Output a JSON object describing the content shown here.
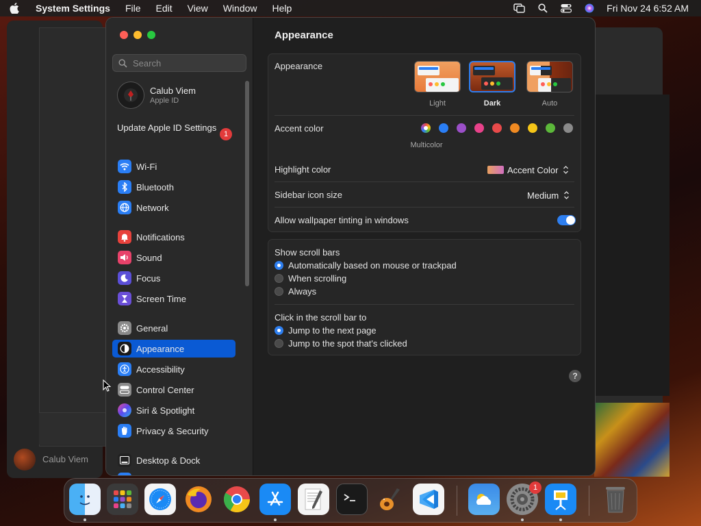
{
  "menubar": {
    "app_name": "System Settings",
    "menus": [
      "File",
      "Edit",
      "View",
      "Window",
      "Help"
    ],
    "clock": "Fri Nov 24  6:52 AM"
  },
  "background": {
    "user_name": "Calub Viem"
  },
  "sidebar": {
    "search_placeholder": "Search",
    "account": {
      "name": "Calub Viem",
      "subtitle": "Apple ID"
    },
    "update": {
      "label": "Update Apple ID Settings",
      "badge": "1"
    },
    "items": [
      {
        "label": "Wi-Fi",
        "icon": "wifi-icon",
        "color": "#2a7ef5"
      },
      {
        "label": "Bluetooth",
        "icon": "bluetooth-icon",
        "color": "#2a7ef5"
      },
      {
        "label": "Network",
        "icon": "globe-icon",
        "color": "#2a7ef5"
      },
      {
        "label": "Notifications",
        "icon": "bell-icon",
        "color": "#e8423c"
      },
      {
        "label": "Sound",
        "icon": "speaker-icon",
        "color": "#e8426a"
      },
      {
        "label": "Focus",
        "icon": "moon-icon",
        "color": "#5b4fd8"
      },
      {
        "label": "Screen Time",
        "icon": "hourglass-icon",
        "color": "#6a4fd8"
      },
      {
        "label": "General",
        "icon": "gear-icon",
        "color": "#8a8a8a"
      },
      {
        "label": "Appearance",
        "icon": "appearance-icon",
        "color": "#1a1a1a",
        "selected": true
      },
      {
        "label": "Accessibility",
        "icon": "accessibility-icon",
        "color": "#2a7ef5"
      },
      {
        "label": "Control Center",
        "icon": "control-center-icon",
        "color": "#8a8a8a"
      },
      {
        "label": "Siri & Spotlight",
        "icon": "siri-icon",
        "color": "#b04ad8"
      },
      {
        "label": "Privacy & Security",
        "icon": "hand-icon",
        "color": "#2a7ef5"
      },
      {
        "label": "Desktop & Dock",
        "icon": "dock-icon",
        "color": "#222222"
      }
    ]
  },
  "content": {
    "title": "Appearance",
    "appearance": {
      "label": "Appearance",
      "options": [
        {
          "label": "Light",
          "selected": false
        },
        {
          "label": "Dark",
          "selected": true
        },
        {
          "label": "Auto",
          "selected": false
        }
      ]
    },
    "accent": {
      "label": "Accent color",
      "selected_caption": "Multicolor",
      "colors": [
        "multicolor",
        "#2a7ef5",
        "#9b4fc8",
        "#e8428a",
        "#e84a4a",
        "#f08a22",
        "#f5c518",
        "#5cb83a",
        "#8a8a8a"
      ]
    },
    "highlight": {
      "label": "Highlight color",
      "value": "Accent Color"
    },
    "sidebar_icon_size": {
      "label": "Sidebar icon size",
      "value": "Medium"
    },
    "wallpaper_tinting": {
      "label": "Allow wallpaper tinting in windows",
      "enabled": true
    },
    "scroll_bars": {
      "label": "Show scroll bars",
      "options": [
        {
          "label": "Automatically based on mouse or trackpad",
          "selected": true
        },
        {
          "label": "When scrolling",
          "selected": false
        },
        {
          "label": "Always",
          "selected": false
        }
      ]
    },
    "click_scroll": {
      "label": "Click in the scroll bar to",
      "options": [
        {
          "label": "Jump to the next page",
          "selected": true
        },
        {
          "label": "Jump to the spot that's clicked",
          "selected": false
        }
      ]
    },
    "help_label": "?"
  },
  "dock": {
    "items": [
      "Finder",
      "Launchpad",
      "Safari",
      "Firefox",
      "Chrome",
      "App Store",
      "TextEdit",
      "Terminal",
      "GarageBand",
      "Visual Studio Code",
      "Weather",
      "System Settings",
      "Keynote",
      "Trash"
    ],
    "settings_badge": "1"
  }
}
